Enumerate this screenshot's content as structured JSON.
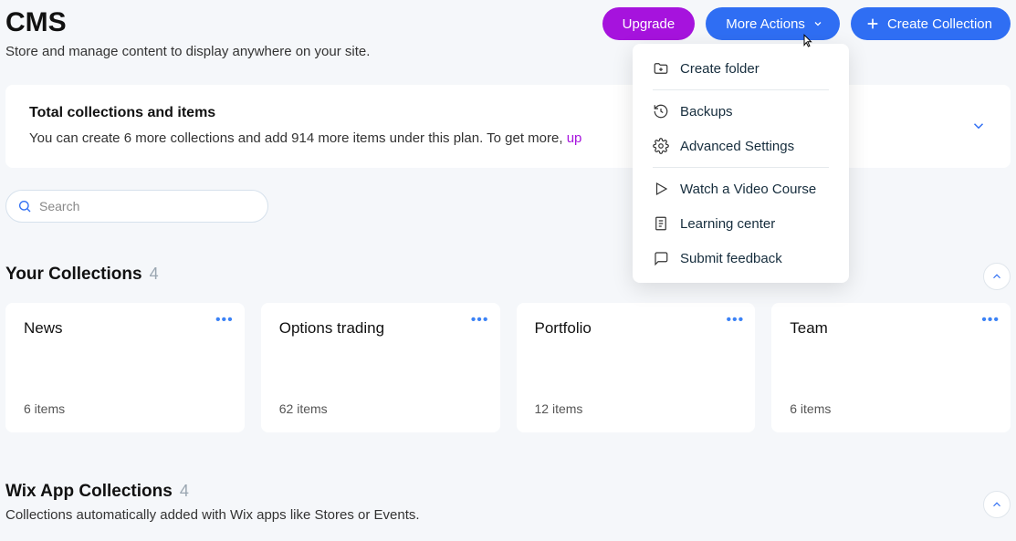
{
  "header": {
    "title": "CMS",
    "subtitle": "Store and manage content to display anywhere on your site.",
    "upgrade_label": "Upgrade",
    "more_actions_label": "More Actions",
    "create_collection_label": "Create Collection"
  },
  "banner": {
    "title": "Total collections and items",
    "text_prefix": "You can create 6 more collections and add 914 more items under this plan. To get more, ",
    "link_text": "up"
  },
  "search": {
    "placeholder": "Search"
  },
  "dropdown": {
    "create_folder": "Create folder",
    "backups": "Backups",
    "advanced_settings": "Advanced Settings",
    "watch_video": "Watch a Video Course",
    "learning_center": "Learning center",
    "submit_feedback": "Submit feedback"
  },
  "your_collections": {
    "title": "Your Collections",
    "count": "4",
    "items": [
      {
        "name": "News",
        "count": "6 items"
      },
      {
        "name": "Options trading",
        "count": "62 items"
      },
      {
        "name": "Portfolio",
        "count": "12 items"
      },
      {
        "name": "Team",
        "count": "6 items"
      }
    ]
  },
  "wix_app_collections": {
    "title": "Wix App Collections",
    "count": "4",
    "subtitle": "Collections automatically added with Wix apps like Stores or Events."
  }
}
